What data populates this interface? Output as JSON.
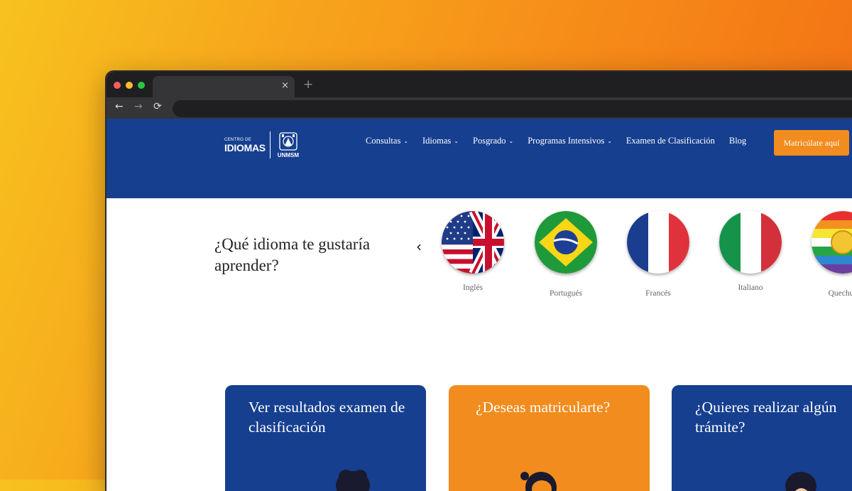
{
  "browser": {
    "tab_close": "×",
    "new_tab": "+",
    "back": "←",
    "forward": "→",
    "reload": "⟳"
  },
  "site": {
    "logo": {
      "small": "CENTRO DE",
      "big": "IDIOMAS",
      "seal_label": "UNMSM"
    },
    "nav": [
      {
        "label": "Consultas",
        "caret": "⌄"
      },
      {
        "label": "Idiomas",
        "caret": "⌄"
      },
      {
        "label": "Posgrado",
        "caret": "⌄"
      },
      {
        "label": "Programas Intensivos",
        "caret": "⌄"
      },
      {
        "label": "Examen de Clasificación"
      },
      {
        "label": "Blog"
      }
    ],
    "cta_label": "Matricúlate aquí",
    "colors": {
      "primary": "#163f8f",
      "accent": "#f28c1e"
    }
  },
  "languages": {
    "question": "¿Qué idioma te gustaría aprender?",
    "prev_icon": "‹",
    "items": [
      {
        "label": "Inglés",
        "icon": "us-uk-flag-icon"
      },
      {
        "label": "Portugués",
        "icon": "brazil-flag-icon"
      },
      {
        "label": "Francés",
        "icon": "france-flag-icon"
      },
      {
        "label": "Italiano",
        "icon": "italy-flag-icon"
      },
      {
        "label": "Quechua",
        "icon": "quechua-flag-icon"
      }
    ]
  },
  "cards": [
    {
      "title": "Ver resultados examen de clasificación",
      "color": "#163f8f"
    },
    {
      "title": "¿Deseas matricularte?",
      "color": "#f28c1e"
    },
    {
      "title": "¿Quieres realizar algún trámite?",
      "color": "#163f8f"
    }
  ]
}
